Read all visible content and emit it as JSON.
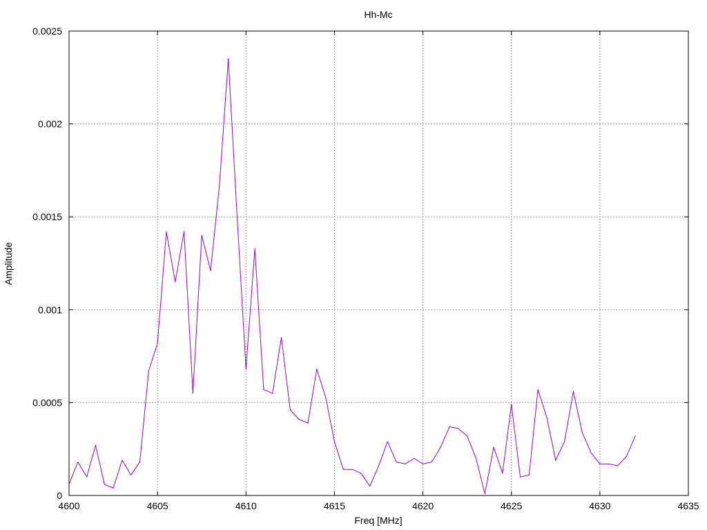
{
  "chart_data": {
    "type": "line",
    "title": "Hh-Mc",
    "xlabel": "Freq [MHz]",
    "ylabel": "Amplitude",
    "xlim": [
      4600,
      4635
    ],
    "ylim": [
      0,
      0.0025
    ],
    "x_ticks": [
      "4600",
      "4605",
      "4610",
      "4615",
      "4620",
      "4625",
      "4630",
      "4635"
    ],
    "y_ticks": [
      "0",
      "0.0005",
      "0.001",
      "0.0015",
      "0.002",
      "0.0025"
    ],
    "grid": true,
    "line_color": "#9400d3",
    "series": [
      {
        "x": [
          4600.0,
          4600.5,
          4601.0,
          4601.5,
          4602.0,
          4602.5,
          4603.0,
          4603.5,
          4604.0,
          4604.5,
          4605.0,
          4605.5,
          4606.0,
          4606.5,
          4607.0,
          4607.5,
          4608.0,
          4608.5,
          4609.0,
          4609.5,
          4610.0,
          4610.5,
          4611.0,
          4611.5,
          4612.0,
          4612.5,
          4613.0,
          4613.5,
          4614.0,
          4614.5,
          4615.0,
          4615.5,
          4616.0,
          4616.5,
          4617.0,
          4617.5,
          4618.0,
          4618.5,
          4619.0,
          4619.5,
          4620.0,
          4620.5,
          4621.0,
          4621.5,
          4622.0,
          4622.5,
          4623.0,
          4623.5,
          4624.0,
          4624.5,
          4625.0,
          4625.5,
          4626.0,
          4626.5,
          4627.0,
          4627.5,
          4628.0,
          4628.5,
          4629.0,
          4629.5,
          4630.0,
          4630.5,
          4631.0,
          4631.5,
          4632.0
        ],
        "values": [
          6e-05,
          0.00018,
          0.0001,
          0.00027,
          6e-05,
          4e-05,
          0.00019,
          0.00011,
          0.00018,
          0.00067,
          0.00082,
          0.00142,
          0.00115,
          0.00142,
          0.00055,
          0.0014,
          0.00121,
          0.00167,
          0.00235,
          0.0015,
          0.00068,
          0.00133,
          0.00057,
          0.00055,
          0.00085,
          0.00046,
          0.00041,
          0.00039,
          0.00068,
          0.00053,
          0.00029,
          0.00014,
          0.00014,
          0.00012,
          5e-05,
          0.00016,
          0.00029,
          0.00018,
          0.00017,
          0.0002,
          0.00017,
          0.00018,
          0.00026,
          0.00037,
          0.00036,
          0.00032,
          0.0002,
          1e-05,
          0.00026,
          0.00012,
          0.00049,
          0.0001,
          0.00011,
          0.00057,
          0.00042,
          0.00019,
          0.00029,
          0.00056,
          0.00034,
          0.00023,
          0.00017,
          0.00017,
          0.00016,
          0.00021,
          0.00032
        ]
      }
    ]
  }
}
